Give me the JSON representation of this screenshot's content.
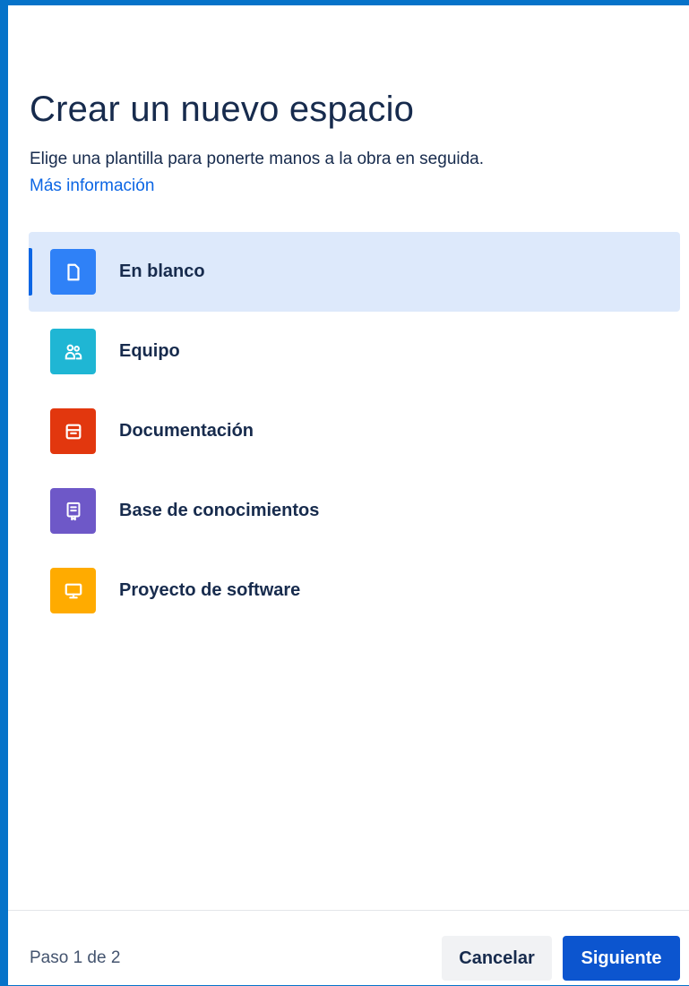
{
  "dialog": {
    "title": "Crear un nuevo espacio",
    "subtitle": "Elige una plantilla para ponerte manos a la obra en seguida.",
    "more_link": "Más información"
  },
  "templates": [
    {
      "label": "En blanco",
      "icon": "page-icon",
      "color": "#2f81f7",
      "selected": true
    },
    {
      "label": "Equipo",
      "icon": "people-icon",
      "color": "#1fb6d4",
      "selected": false
    },
    {
      "label": "Documentación",
      "icon": "archive-icon",
      "color": "#e2370e",
      "selected": false
    },
    {
      "label": "Base de conocimientos",
      "icon": "book-icon",
      "color": "#6e58c8",
      "selected": false
    },
    {
      "label": "Proyecto de software",
      "icon": "monitor-icon",
      "color": "#ffab00",
      "selected": false
    }
  ],
  "footer": {
    "step": "Paso 1 de 2",
    "cancel_label": "Cancelar",
    "next_label": "Siguiente"
  },
  "colors": {
    "frame": "#0673c9",
    "accent": "#0c66e4",
    "primary_button": "#0c55cf",
    "selected_bg": "#dde9fb"
  }
}
